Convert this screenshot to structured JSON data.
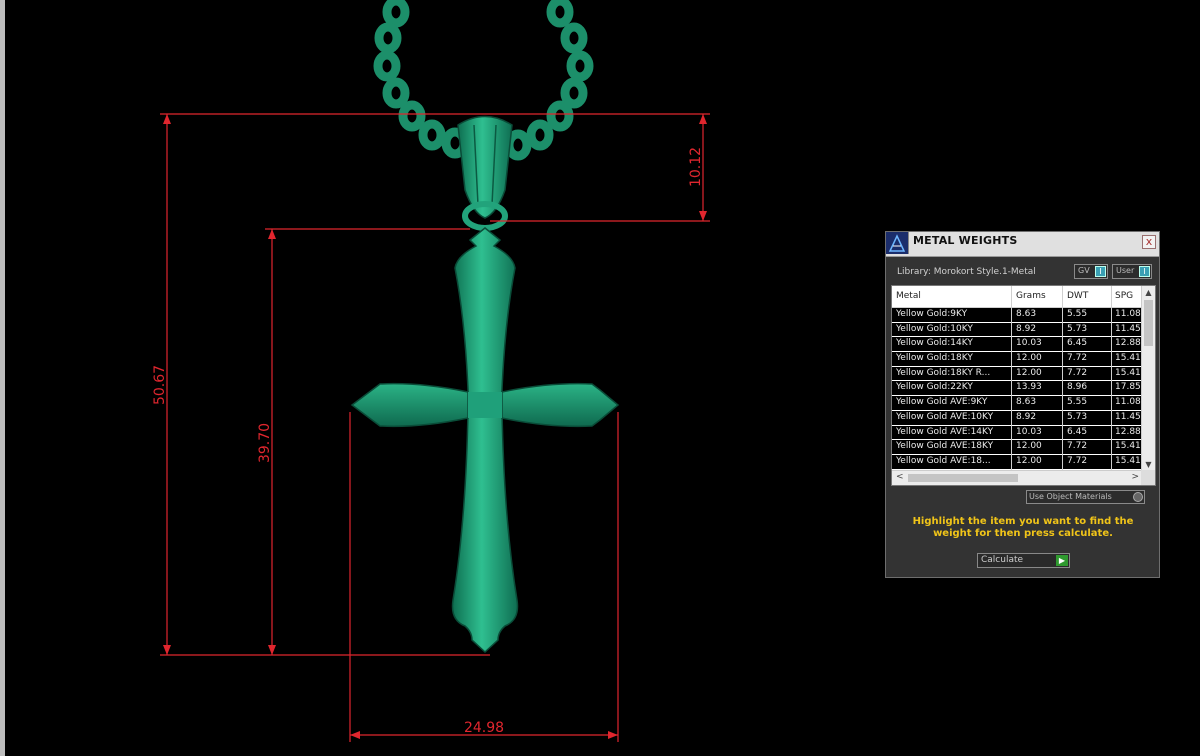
{
  "viewport": {
    "dimensions": {
      "overall_height": "50.67",
      "cross_height": "39.70",
      "bail_height": "10.12",
      "width": "24.98"
    }
  },
  "panel": {
    "title": "METAL WEIGHTS",
    "close_label": "x",
    "library_label": "Library: Morokort Style.1-Metal",
    "gv_label": "GV",
    "gv_button": "I",
    "user_label": "User",
    "user_button": "I",
    "columns": [
      "Metal",
      "Grams",
      "DWT",
      "SPG"
    ],
    "rows": [
      [
        "Yellow Gold:9KY",
        "8.63",
        "5.55",
        "11.08"
      ],
      [
        "Yellow Gold:10KY",
        "8.92",
        "5.73",
        "11.45"
      ],
      [
        "Yellow Gold:14KY",
        "10.03",
        "6.45",
        "12.88"
      ],
      [
        "Yellow Gold:18KY",
        "12.00",
        "7.72",
        "15.41"
      ],
      [
        "Yellow Gold:18KY R...",
        "12.00",
        "7.72",
        "15.41"
      ],
      [
        "Yellow Gold:22KY",
        "13.93",
        "8.96",
        "17.85"
      ],
      [
        "Yellow Gold AVE:9KY",
        "8.63",
        "5.55",
        "11.08"
      ],
      [
        "Yellow Gold AVE:10KY",
        "8.92",
        "5.73",
        "11.45"
      ],
      [
        "Yellow Gold AVE:14KY",
        "10.03",
        "6.45",
        "12.88"
      ],
      [
        "Yellow Gold AVE:18KY",
        "12.00",
        "7.72",
        "15.41"
      ],
      [
        "Yellow Gold AVE:18...",
        "12.00",
        "7.72",
        "15.41"
      ]
    ],
    "use_materials_label": "Use Object Materials",
    "instructions": "Highlight the item you want to find the weight for then press calculate.",
    "calculate_label": "Calculate",
    "calculate_arrow": "▶",
    "scroll_up": "▲",
    "scroll_down": "▼",
    "scroll_left": "<",
    "scroll_right": ">"
  },
  "colors": {
    "pendant": "#1fa07a",
    "dimension_lines": "#e0262e",
    "instruction_text": "#f0c419"
  }
}
